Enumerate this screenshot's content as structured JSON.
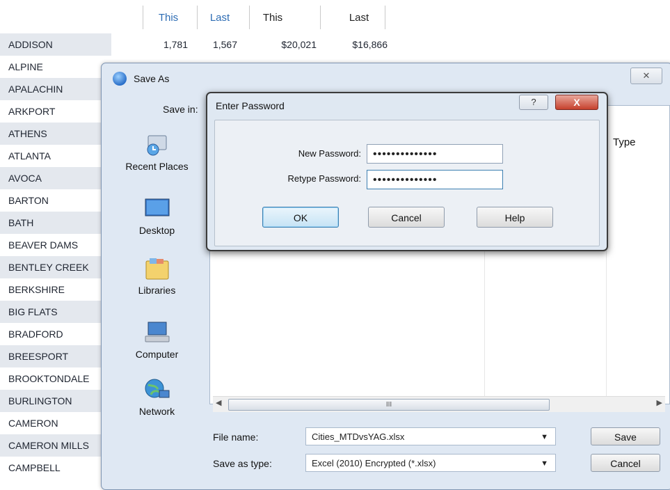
{
  "sheet": {
    "headers": [
      "This",
      "Last",
      "This",
      "Last"
    ],
    "rows": [
      {
        "name": "ADDISON",
        "c1": "1,781",
        "c2": "1,567",
        "c3": "$20,021",
        "c4": "$16,866"
      },
      {
        "name": "ALPINE"
      },
      {
        "name": "APALACHIN"
      },
      {
        "name": "ARKPORT"
      },
      {
        "name": "ATHENS"
      },
      {
        "name": "ATLANTA"
      },
      {
        "name": "AVOCA"
      },
      {
        "name": "BARTON"
      },
      {
        "name": "BATH"
      },
      {
        "name": "BEAVER DAMS"
      },
      {
        "name": "BENTLEY CREEK"
      },
      {
        "name": "BERKSHIRE"
      },
      {
        "name": "BIG FLATS"
      },
      {
        "name": "BRADFORD"
      },
      {
        "name": "BREESPORT"
      },
      {
        "name": "BROOKTONDALE"
      },
      {
        "name": "BURLINGTON"
      },
      {
        "name": "CAMERON"
      },
      {
        "name": "CAMERON MILLS"
      },
      {
        "name": "CAMPBELL"
      }
    ]
  },
  "save_as": {
    "title": "Save As",
    "close": "✕",
    "save_in_label": "Save in:",
    "places": [
      "Recent Places",
      "Desktop",
      "Libraries",
      "Computer",
      "Network"
    ],
    "column_type": "Type",
    "scroll_thumb": "III",
    "file_name_label": "File name:",
    "file_name_value": "Cities_MTDvsYAG.xlsx",
    "save_as_type_label": "Save as type:",
    "save_as_type_value": "Excel (2010) Encrypted (*.xlsx)",
    "save_button": "Save",
    "cancel_button": "Cancel"
  },
  "password_dialog": {
    "title": "Enter Password",
    "help_glyph": "?",
    "close_glyph": "X",
    "new_password_label": "New Password:",
    "new_password_value": "••••••••••••••",
    "retype_password_label": "Retype Password:",
    "retype_password_value": "••••••••••••••",
    "ok_button": "OK",
    "cancel_button": "Cancel",
    "help_button": "Help"
  }
}
